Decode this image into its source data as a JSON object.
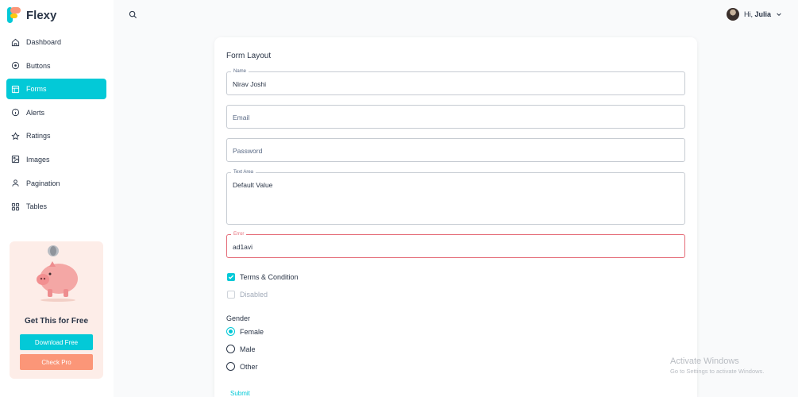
{
  "app": {
    "name": "Flexy"
  },
  "sidebar": {
    "items": [
      {
        "label": "Dashboard",
        "icon": "home-icon",
        "active": false
      },
      {
        "label": "Buttons",
        "icon": "circle-icon",
        "active": false
      },
      {
        "label": "Forms",
        "icon": "table-icon",
        "active": true
      },
      {
        "label": "Alerts",
        "icon": "info-icon",
        "active": false
      },
      {
        "label": "Ratings",
        "icon": "star-icon",
        "active": false
      },
      {
        "label": "Images",
        "icon": "image-icon",
        "active": false
      },
      {
        "label": "Pagination",
        "icon": "user-icon",
        "active": false
      },
      {
        "label": "Tables",
        "icon": "grid-icon",
        "active": false
      }
    ],
    "promo": {
      "title": "Get This for Free",
      "download_label": "Download Free",
      "pro_label": "Check Pro"
    }
  },
  "header": {
    "greeting": "Hi,",
    "user_name": "Julia"
  },
  "form": {
    "title": "Form Layout",
    "name": {
      "label": "Name",
      "value": "Nirav Joshi"
    },
    "email": {
      "placeholder": "Email"
    },
    "password": {
      "placeholder": "Password"
    },
    "textarea": {
      "label": "Text Area",
      "value": "Default Value"
    },
    "error": {
      "label": "Error",
      "value": "ad1avi"
    },
    "terms": {
      "label": "Terms & Condition",
      "checked": true
    },
    "disabled": {
      "label": "Disabled",
      "checked": false
    },
    "gender": {
      "label": "Gender",
      "options": [
        {
          "label": "Female",
          "selected": true
        },
        {
          "label": "Male",
          "selected": false
        },
        {
          "label": "Other",
          "selected": false
        }
      ]
    },
    "submit_label": "Submit"
  },
  "watermark": {
    "line1": "Activate Windows",
    "line2": "Go to Settings to activate Windows."
  },
  "colors": {
    "primary": "#03c9d7",
    "secondary": "#fb9678",
    "error": "#e46a76",
    "text": "#2a3547"
  }
}
